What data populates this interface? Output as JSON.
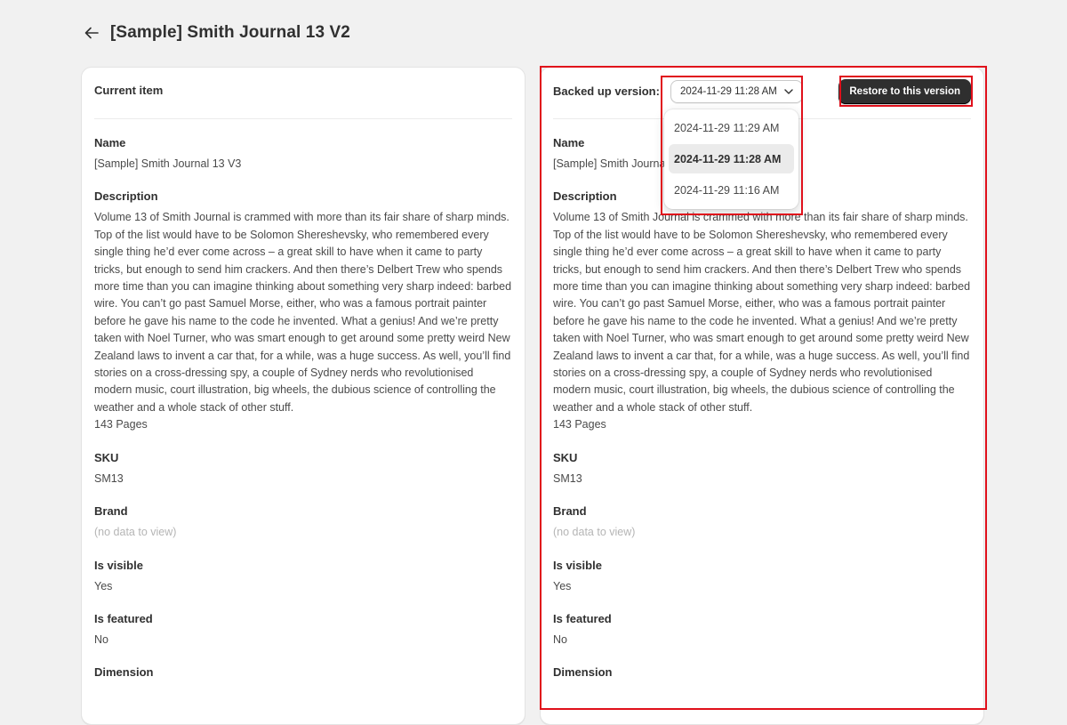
{
  "header": {
    "title": "[Sample] Smith Journal 13 V2",
    "back_icon": "arrow-left-icon"
  },
  "current": {
    "heading": "Current item",
    "fields": {
      "name_label": "Name",
      "name_value": "[Sample] Smith Journal 13 V3",
      "desc_label": "Description",
      "desc_value": "Volume 13 of Smith Journal is crammed with more than its fair share of sharp minds. Top of the list would have to be Solomon Shereshevsky, who remembered every single thing he’d ever come across – a great skill to have when it came to party tricks, but enough to send him crackers. And then there’s Delbert Trew who spends more time than you can imagine thinking about something very sharp indeed: barbed wire. You can’t go past Samuel Morse, either, who was a famous portrait painter before he gave his name to the code he invented. What a genius! And we’re pretty taken with Noel Turner, who was smart enough to get around some pretty weird New Zealand laws to invent a car that, for a while, was a huge success. As well, you’ll find stories on a cross-dressing spy, a couple of Sydney nerds who revolutionised modern music, court illustration, big wheels, the dubious science of controlling the weather and a whole stack of other stuff.",
      "pages": "143 Pages",
      "sku_label": "SKU",
      "sku_value": "SM13",
      "brand_label": "Brand",
      "brand_value": "(no data to view)",
      "visible_label": "Is visible",
      "visible_value": "Yes",
      "featured_label": "Is featured",
      "featured_value": "No",
      "dimension_label": "Dimension"
    }
  },
  "backup": {
    "label": "Backed up version:",
    "selected_version": "2024-11-29 11:28 AM",
    "restore_label": "Restore to this version",
    "dropdown_options": [
      "2024-11-29 11:29 AM",
      "2024-11-29 11:28 AM",
      "2024-11-29 11:16 AM"
    ],
    "fields": {
      "name_label": "Name",
      "name_value": "[Sample] Smith Journal 13 V2",
      "desc_label": "Description",
      "desc_value": "Volume 13 of Smith Journal is crammed with more than its fair share of sharp minds. Top of the list would have to be Solomon Shereshevsky, who remembered every single thing he’d ever come across – a great skill to have when it came to party tricks, but enough to send him crackers. And then there’s Delbert Trew who spends more time than you can imagine thinking about something very sharp indeed: barbed wire. You can’t go past Samuel Morse, either, who was a famous portrait painter before he gave his name to the code he invented. What a genius! And we’re pretty taken with Noel Turner, who was smart enough to get around some pretty weird New Zealand laws to invent a car that, for a while, was a huge success. As well, you’ll find stories on a cross-dressing spy, a couple of Sydney nerds who revolutionised modern music, court illustration, big wheels, the dubious science of controlling the weather and a whole stack of other stuff.",
      "pages": "143 Pages",
      "sku_label": "SKU",
      "sku_value": "SM13",
      "brand_label": "Brand",
      "brand_value": "(no data to view)",
      "visible_label": "Is visible",
      "visible_value": "Yes",
      "featured_label": "Is featured",
      "featured_value": "No",
      "dimension_label": "Dimension"
    }
  },
  "colors": {
    "highlight": "#e0101b",
    "button": "#2f2f2f",
    "background": "#f1f1f1"
  }
}
